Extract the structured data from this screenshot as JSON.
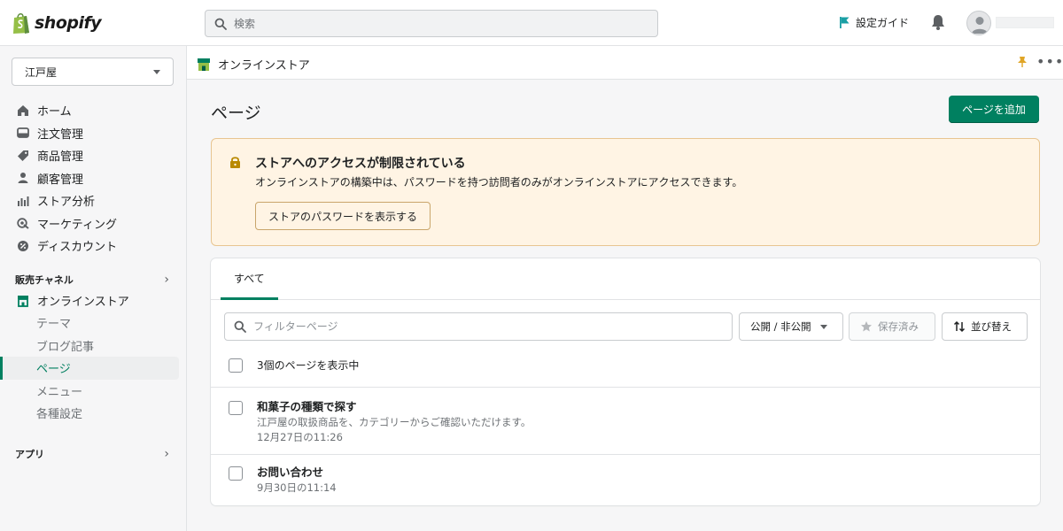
{
  "topbar": {
    "logo_text": "shopify",
    "search_placeholder": "検索",
    "setup_guide": "設定ガイド"
  },
  "sidebar": {
    "store_name": "江戸屋",
    "items": [
      {
        "label": "ホーム",
        "icon": "home-icon"
      },
      {
        "label": "注文管理",
        "icon": "orders-icon"
      },
      {
        "label": "商品管理",
        "icon": "tag-icon"
      },
      {
        "label": "顧客管理",
        "icon": "person-icon"
      },
      {
        "label": "ストア分析",
        "icon": "analytics-icon"
      },
      {
        "label": "マーケティング",
        "icon": "marketing-icon"
      },
      {
        "label": "ディスカウント",
        "icon": "discount-icon"
      }
    ],
    "sales_channels_label": "販売チャネル",
    "online_store_label": "オンラインストア",
    "sub_items": [
      "テーマ",
      "ブログ記事",
      "ページ",
      "メニュー",
      "各種設定"
    ],
    "active_sub_index": 2,
    "apps_label": "アプリ"
  },
  "breadcrumb": {
    "label": "オンラインストア"
  },
  "page": {
    "title": "ページ",
    "add_button": "ページを追加"
  },
  "banner": {
    "title": "ストアへのアクセスが制限されている",
    "description": "オンラインストアの構築中は、パスワードを持つ訪問者のみがオンラインストアにアクセスできます。",
    "button": "ストアのパスワードを表示する"
  },
  "list": {
    "tab_all": "すべて",
    "filter_placeholder": "フィルターページ",
    "visibility_button": "公開 / 非公開",
    "saved_button": "保存済み",
    "sort_button": "並び替え",
    "count_label": "3個のページを表示中",
    "rows": [
      {
        "title": "和菓子の種類で探す",
        "description": "江戸屋の取扱商品を、カテゴリーからご確認いただけます。",
        "date": "12月27日の11:26"
      },
      {
        "title": "お問い合わせ",
        "description": "",
        "date": "9月30日の11:14"
      }
    ]
  },
  "colors": {
    "primary": "#008060",
    "banner_bg": "#fff4e4",
    "banner_border": "#e8c591",
    "flag": "#1a9fa4",
    "lock": "#b98900"
  }
}
